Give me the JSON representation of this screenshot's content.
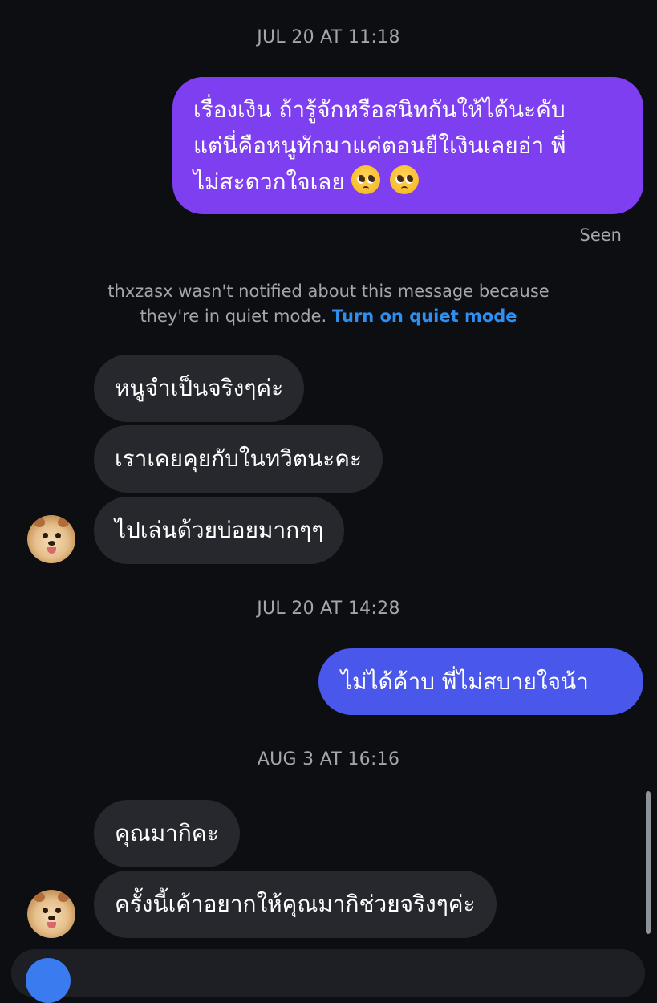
{
  "thread": {
    "timestamps": [
      "JUL 20 AT 11:18",
      "JUL 20 AT 14:28",
      "AUG 3 AT 16:16"
    ],
    "outgoing_1": {
      "lines": [
        "เรื่องเงิน ถ้ารู้จักหรือสนิทกันให้ได้นะคับ",
        "แต่นี่คือหนูทักมาแค่ตอนยืใเงินเลยอ่า พี่",
        "ไม่สะดวกใจเลย"
      ],
      "emoji": [
        "pleading-face-emoji",
        "pleading-face-emoji"
      ],
      "color": "#7e3ff0"
    },
    "seen_label": "Seen",
    "notice": {
      "line1": "thxzasx wasn't notified about this message because",
      "line2": "they're in quiet mode.",
      "link": "Turn on quiet mode",
      "link_color": "#2e8ff0"
    },
    "incoming_group_1": [
      "หนูจำเป็นจริงๆค่ะ",
      "เราเคยคุยกับในทวิตนะคะ",
      "ไปเล่นด้วยบ่อยมากๆๆ"
    ],
    "outgoing_2": {
      "text": "ไม่ได้ค้าบ พี่ไม่สบายใจน้า",
      "color": "#4957ea"
    },
    "incoming_group_2": [
      "คุณมากิคะ",
      "ครั้งนี้เค้าอยากให้คุณมากิช่วยจริงๆค่ะ"
    ],
    "incoming_bubble_color": "#26282d",
    "background_color": "#0c0e12"
  }
}
